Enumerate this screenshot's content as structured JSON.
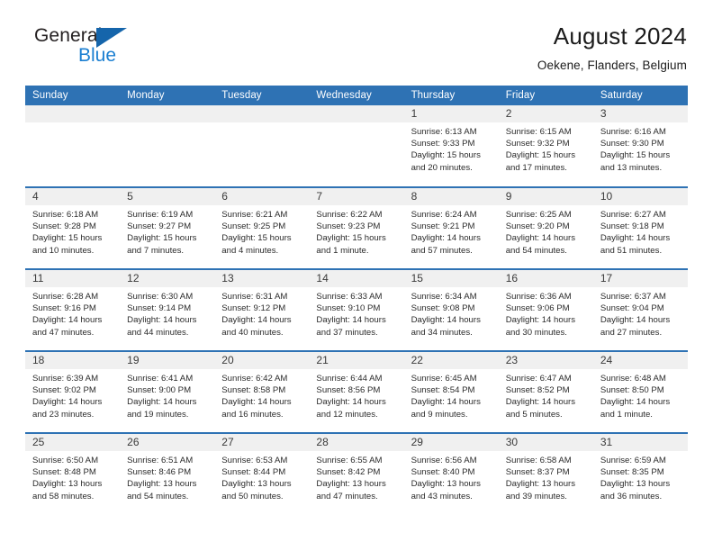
{
  "brand": {
    "word_one": "General",
    "word_two": "Blue",
    "mark": "triangle-logo",
    "accent_dark": "#1565ab",
    "accent_light": "#1b7fd1"
  },
  "header": {
    "title": "August 2024",
    "location": "Oekene, Flanders, Belgium",
    "header_bg": "#2e72b4",
    "daynum_bg": "#f0f0f0"
  },
  "weekdays": [
    "Sunday",
    "Monday",
    "Tuesday",
    "Wednesday",
    "Thursday",
    "Friday",
    "Saturday"
  ],
  "labels": {
    "sunrise_prefix": "Sunrise: ",
    "sunset_prefix": "Sunset: ",
    "daylight_prefix": "Daylight: "
  },
  "weeks": [
    [
      {
        "day": "",
        "blank": true
      },
      {
        "day": "",
        "blank": true
      },
      {
        "day": "",
        "blank": true
      },
      {
        "day": "",
        "blank": true
      },
      {
        "day": "1",
        "sunrise": "Sunrise: 6:13 AM",
        "sunset": "Sunset: 9:33 PM",
        "daylight": "Daylight: 15 hours and 20 minutes."
      },
      {
        "day": "2",
        "sunrise": "Sunrise: 6:15 AM",
        "sunset": "Sunset: 9:32 PM",
        "daylight": "Daylight: 15 hours and 17 minutes."
      },
      {
        "day": "3",
        "sunrise": "Sunrise: 6:16 AM",
        "sunset": "Sunset: 9:30 PM",
        "daylight": "Daylight: 15 hours and 13 minutes."
      }
    ],
    [
      {
        "day": "4",
        "sunrise": "Sunrise: 6:18 AM",
        "sunset": "Sunset: 9:28 PM",
        "daylight": "Daylight: 15 hours and 10 minutes."
      },
      {
        "day": "5",
        "sunrise": "Sunrise: 6:19 AM",
        "sunset": "Sunset: 9:27 PM",
        "daylight": "Daylight: 15 hours and 7 minutes."
      },
      {
        "day": "6",
        "sunrise": "Sunrise: 6:21 AM",
        "sunset": "Sunset: 9:25 PM",
        "daylight": "Daylight: 15 hours and 4 minutes."
      },
      {
        "day": "7",
        "sunrise": "Sunrise: 6:22 AM",
        "sunset": "Sunset: 9:23 PM",
        "daylight": "Daylight: 15 hours and 1 minute."
      },
      {
        "day": "8",
        "sunrise": "Sunrise: 6:24 AM",
        "sunset": "Sunset: 9:21 PM",
        "daylight": "Daylight: 14 hours and 57 minutes."
      },
      {
        "day": "9",
        "sunrise": "Sunrise: 6:25 AM",
        "sunset": "Sunset: 9:20 PM",
        "daylight": "Daylight: 14 hours and 54 minutes."
      },
      {
        "day": "10",
        "sunrise": "Sunrise: 6:27 AM",
        "sunset": "Sunset: 9:18 PM",
        "daylight": "Daylight: 14 hours and 51 minutes."
      }
    ],
    [
      {
        "day": "11",
        "sunrise": "Sunrise: 6:28 AM",
        "sunset": "Sunset: 9:16 PM",
        "daylight": "Daylight: 14 hours and 47 minutes."
      },
      {
        "day": "12",
        "sunrise": "Sunrise: 6:30 AM",
        "sunset": "Sunset: 9:14 PM",
        "daylight": "Daylight: 14 hours and 44 minutes."
      },
      {
        "day": "13",
        "sunrise": "Sunrise: 6:31 AM",
        "sunset": "Sunset: 9:12 PM",
        "daylight": "Daylight: 14 hours and 40 minutes."
      },
      {
        "day": "14",
        "sunrise": "Sunrise: 6:33 AM",
        "sunset": "Sunset: 9:10 PM",
        "daylight": "Daylight: 14 hours and 37 minutes."
      },
      {
        "day": "15",
        "sunrise": "Sunrise: 6:34 AM",
        "sunset": "Sunset: 9:08 PM",
        "daylight": "Daylight: 14 hours and 34 minutes."
      },
      {
        "day": "16",
        "sunrise": "Sunrise: 6:36 AM",
        "sunset": "Sunset: 9:06 PM",
        "daylight": "Daylight: 14 hours and 30 minutes."
      },
      {
        "day": "17",
        "sunrise": "Sunrise: 6:37 AM",
        "sunset": "Sunset: 9:04 PM",
        "daylight": "Daylight: 14 hours and 27 minutes."
      }
    ],
    [
      {
        "day": "18",
        "sunrise": "Sunrise: 6:39 AM",
        "sunset": "Sunset: 9:02 PM",
        "daylight": "Daylight: 14 hours and 23 minutes."
      },
      {
        "day": "19",
        "sunrise": "Sunrise: 6:41 AM",
        "sunset": "Sunset: 9:00 PM",
        "daylight": "Daylight: 14 hours and 19 minutes."
      },
      {
        "day": "20",
        "sunrise": "Sunrise: 6:42 AM",
        "sunset": "Sunset: 8:58 PM",
        "daylight": "Daylight: 14 hours and 16 minutes."
      },
      {
        "day": "21",
        "sunrise": "Sunrise: 6:44 AM",
        "sunset": "Sunset: 8:56 PM",
        "daylight": "Daylight: 14 hours and 12 minutes."
      },
      {
        "day": "22",
        "sunrise": "Sunrise: 6:45 AM",
        "sunset": "Sunset: 8:54 PM",
        "daylight": "Daylight: 14 hours and 9 minutes."
      },
      {
        "day": "23",
        "sunrise": "Sunrise: 6:47 AM",
        "sunset": "Sunset: 8:52 PM",
        "daylight": "Daylight: 14 hours and 5 minutes."
      },
      {
        "day": "24",
        "sunrise": "Sunrise: 6:48 AM",
        "sunset": "Sunset: 8:50 PM",
        "daylight": "Daylight: 14 hours and 1 minute."
      }
    ],
    [
      {
        "day": "25",
        "sunrise": "Sunrise: 6:50 AM",
        "sunset": "Sunset: 8:48 PM",
        "daylight": "Daylight: 13 hours and 58 minutes."
      },
      {
        "day": "26",
        "sunrise": "Sunrise: 6:51 AM",
        "sunset": "Sunset: 8:46 PM",
        "daylight": "Daylight: 13 hours and 54 minutes."
      },
      {
        "day": "27",
        "sunrise": "Sunrise: 6:53 AM",
        "sunset": "Sunset: 8:44 PM",
        "daylight": "Daylight: 13 hours and 50 minutes."
      },
      {
        "day": "28",
        "sunrise": "Sunrise: 6:55 AM",
        "sunset": "Sunset: 8:42 PM",
        "daylight": "Daylight: 13 hours and 47 minutes."
      },
      {
        "day": "29",
        "sunrise": "Sunrise: 6:56 AM",
        "sunset": "Sunset: 8:40 PM",
        "daylight": "Daylight: 13 hours and 43 minutes."
      },
      {
        "day": "30",
        "sunrise": "Sunrise: 6:58 AM",
        "sunset": "Sunset: 8:37 PM",
        "daylight": "Daylight: 13 hours and 39 minutes."
      },
      {
        "day": "31",
        "sunrise": "Sunrise: 6:59 AM",
        "sunset": "Sunset: 8:35 PM",
        "daylight": "Daylight: 13 hours and 36 minutes."
      }
    ]
  ]
}
